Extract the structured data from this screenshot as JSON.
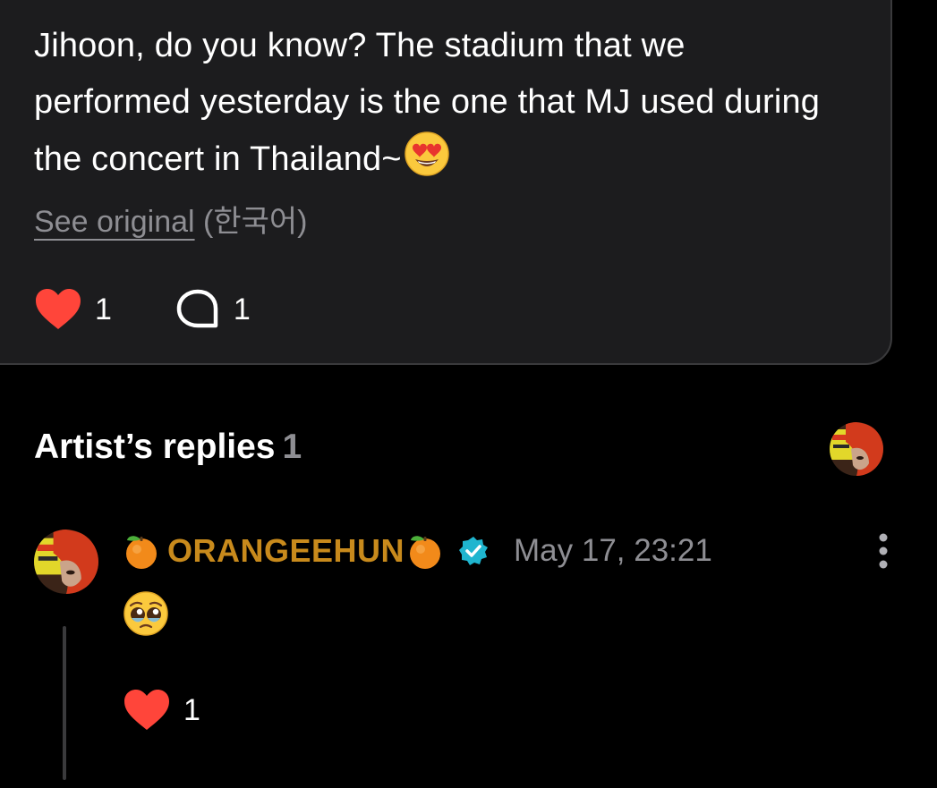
{
  "post": {
    "text": "Jihoon, do you know? The stadium that we performed yesterday is the one that MJ used during the concert in Thailand~",
    "text_emoji": "heart-eyes-emoji",
    "see_original_label": "See original",
    "original_language": "(한국어)",
    "like_count": "1",
    "comment_count": "1"
  },
  "replies": {
    "title": "Artist’s replies",
    "count": "1",
    "items": [
      {
        "author": "ORANGEEHUN",
        "verified": true,
        "timestamp": "May 17, 23:21",
        "content_emoji": "pleading-face-emoji",
        "like_count": "1"
      }
    ]
  },
  "colors": {
    "background": "#000000",
    "card": "#1c1c1e",
    "card_border": "#3a3a3c",
    "like_red": "#ff453a",
    "author_orange": "#c88a1c",
    "verified_teal": "#1fb5cf",
    "secondary_text": "#8e8e93"
  },
  "icons": [
    "heart-icon",
    "comment-bubble-icon",
    "verified-badge-icon",
    "more-vertical-icon",
    "orange-emoji-icon"
  ]
}
